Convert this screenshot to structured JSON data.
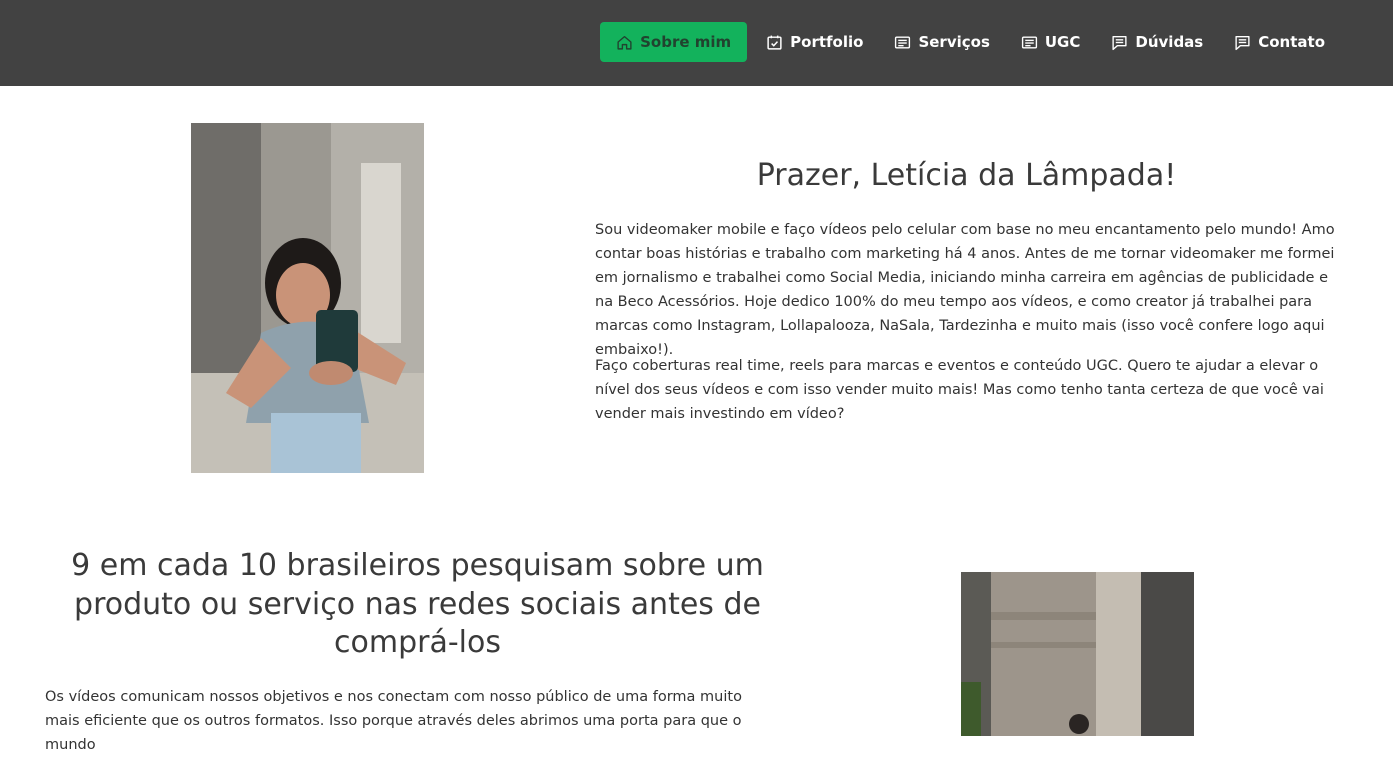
{
  "nav": {
    "items": [
      {
        "label": "Sobre mim",
        "icon": "home-icon",
        "active": true
      },
      {
        "label": "Portfolio",
        "icon": "calendar-check-icon",
        "active": false
      },
      {
        "label": "Serviços",
        "icon": "list-card-icon",
        "active": false
      },
      {
        "label": "UGC",
        "icon": "list-card-icon",
        "active": false
      },
      {
        "label": "Dúvidas",
        "icon": "chat-lines-icon",
        "active": false
      },
      {
        "label": "Contato",
        "icon": "chat-lines-icon",
        "active": false
      }
    ]
  },
  "intro": {
    "title": "Prazer, Letícia da Lâmpada!",
    "paragraph1": "Sou videomaker mobile e faço vídeos pelo celular com base no meu encantamento pelo mundo! Amo contar boas histórias e trabalho com marketing há 4 anos. Antes de me tornar videomaker me formei em jornalismo e trabalhei como Social Media, iniciando minha carreira em agências de publicidade e na Beco Acessórios. Hoje dedico 100% do meu tempo aos vídeos, e como creator já trabalhei para marcas como Instagram, Lollapalooza, NaSala, Tardezinha e muito mais (isso você confere logo aqui embaixo!).",
    "paragraph2": "Faço coberturas real time, reels para marcas e eventos e conteúdo UGC. Quero te ajudar a elevar o nível dos seus vídeos e com isso vender muito mais! Mas como tenho tanta certeza de que você vai vender mais investindo em vídeo?"
  },
  "stat": {
    "title": "9 em cada 10 brasileiros pesquisam sobre um produto ou serviço nas redes sociais antes de comprá-los",
    "paragraph": "Os vídeos comunicam nossos objetivos e nos conectam com nosso público de uma forma muito mais eficiente que os outros formatos. Isso porque através deles abrimos uma porta para que o mundo"
  },
  "colors": {
    "navbar_bg": "#424242",
    "accent_green": "#13b25c",
    "text": "#3a3a3a"
  }
}
